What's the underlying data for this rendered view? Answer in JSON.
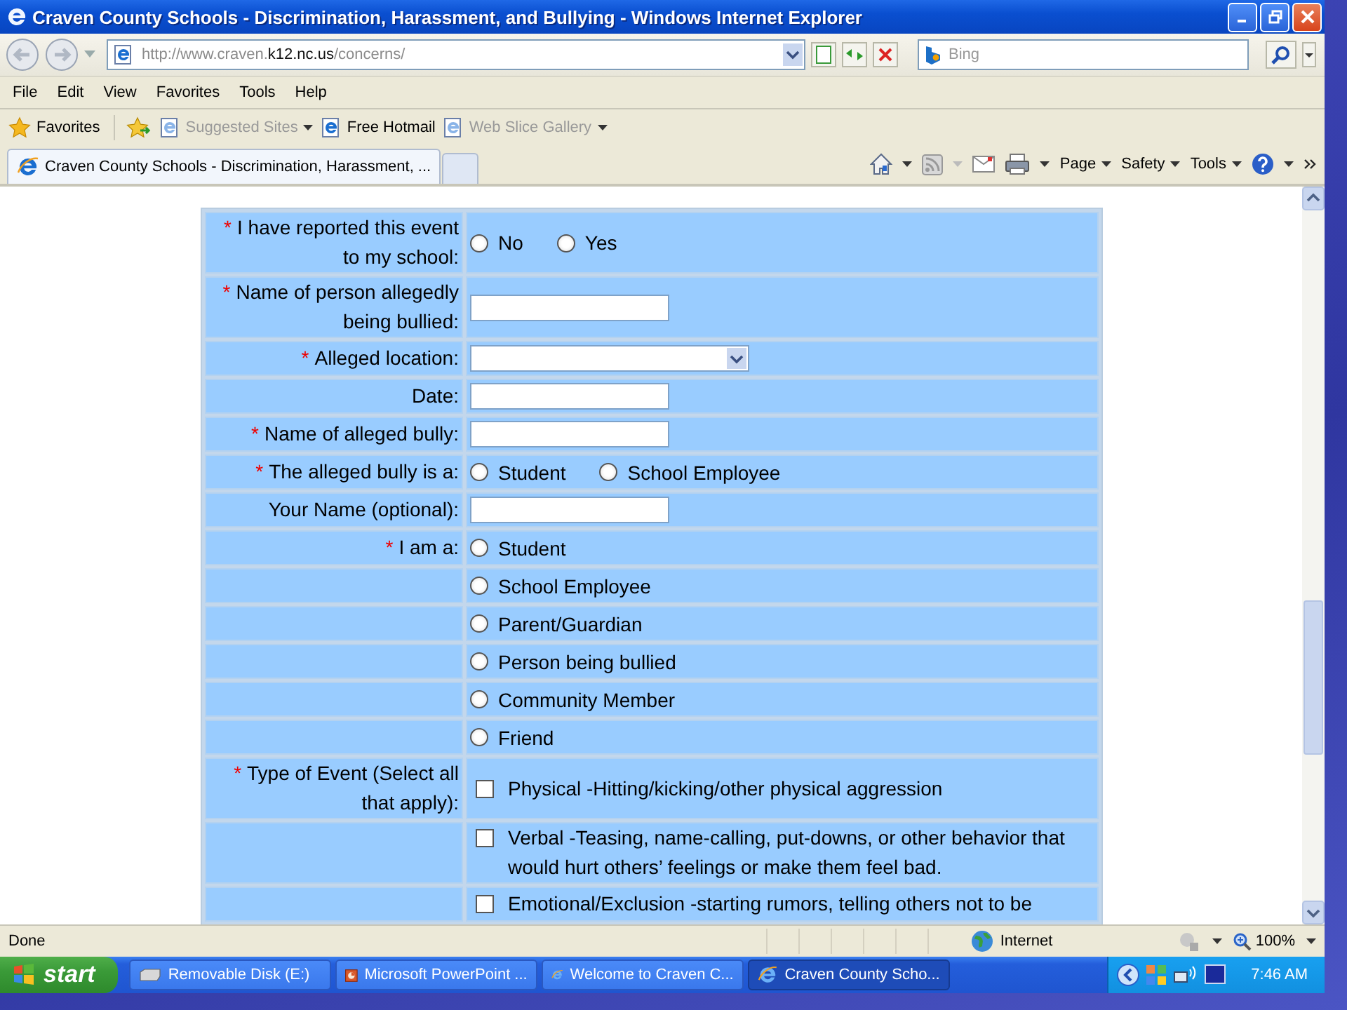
{
  "window": {
    "title": "Craven County Schools - Discrimination, Harassment, and Bullying - Windows Internet Explorer"
  },
  "address_bar": {
    "url": "http://www.craven.**k12.nc.us**/concerns/"
  },
  "search": {
    "placeholder": "Bing"
  },
  "menu": [
    "File",
    "Edit",
    "View",
    "Favorites",
    "Tools",
    "Help"
  ],
  "favorites_bar": {
    "label": "Favorites",
    "items": [
      {
        "label": "Suggested Sites",
        "disabled": true,
        "dropdown": true
      },
      {
        "label": "Free Hotmail",
        "disabled": false,
        "dropdown": false
      },
      {
        "label": "Web Slice Gallery",
        "disabled": true,
        "dropdown": true
      }
    ]
  },
  "tabs": [
    {
      "label": "Craven County Schools - Discrimination, Harassment, ...",
      "selected": true
    }
  ],
  "command_bar": [
    "Page",
    "Safety",
    "Tools"
  ],
  "form": {
    "rows": [
      {
        "label": "I have reported this event to my school:",
        "required_mark": "*",
        "kind": "radio",
        "options": [
          {
            "label": "No",
            "selected": false
          },
          {
            "label": "Yes",
            "selected": false
          }
        ]
      },
      {
        "label": "Name of person allegedly being bullied:",
        "required_mark": "*",
        "kind": "text"
      },
      {
        "label": "Alleged location:",
        "required_mark": "*",
        "kind": "select"
      },
      {
        "label": "Date:",
        "kind": "text"
      },
      {
        "label": "Name of alleged bully:",
        "required_mark": "*",
        "kind": "text"
      },
      {
        "label": "The alleged bully is a:",
        "required_mark": "*",
        "kind": "radio",
        "options": [
          {
            "label": "Student",
            "selected": false
          },
          {
            "label": "School Employee",
            "selected": false
          }
        ]
      },
      {
        "label": "Your Name (optional):",
        "kind": "text"
      },
      {
        "label": "I am a:",
        "required_mark": "*",
        "kind": "radio",
        "options": [
          {
            "label": "Student",
            "selected": false
          }
        ]
      },
      {
        "kind": "radio",
        "options": [
          {
            "label": "School Employee",
            "selected": false
          }
        ]
      },
      {
        "kind": "radio",
        "options": [
          {
            "label": "Parent/Guardian",
            "selected": false
          }
        ]
      },
      {
        "kind": "radio",
        "options": [
          {
            "label": "Person being bullied",
            "selected": false
          }
        ]
      },
      {
        "kind": "radio",
        "options": [
          {
            "label": "Community Member",
            "selected": false
          }
        ]
      },
      {
        "kind": "radio",
        "options": [
          {
            "label": "Friend",
            "selected": false
          }
        ]
      },
      {
        "label": "Type of Event (Select all that apply):",
        "required_mark": "*",
        "kind": "checkbox",
        "text": "Physical -Hitting/kicking/other physical aggression",
        "checked": false
      },
      {
        "kind": "checkbox",
        "text": "Verbal -Teasing, name-calling, put-downs, or other behavior that would hurt others’ feelings or make them feel bad.",
        "checked": false
      },
      {
        "kind": "checkbox",
        "text": "Emotional/Exclusion -starting rumors, telling others not to be",
        "checked": false
      }
    ]
  },
  "status_bar": {
    "text": "Done",
    "zone": "Internet",
    "zoom": "100%"
  },
  "taskbar": {
    "start": "start",
    "items": [
      {
        "label": "Removable Disk (E:)",
        "kind": "drive",
        "selected": false
      },
      {
        "label": "Microsoft PowerPoint ...",
        "kind": "presentation",
        "selected": false
      },
      {
        "label": "Welcome to Craven C...",
        "kind": "browser",
        "selected": false
      },
      {
        "label": "Craven County Scho...",
        "kind": "browser",
        "selected": true
      }
    ],
    "clock": "7:46 AM"
  }
}
